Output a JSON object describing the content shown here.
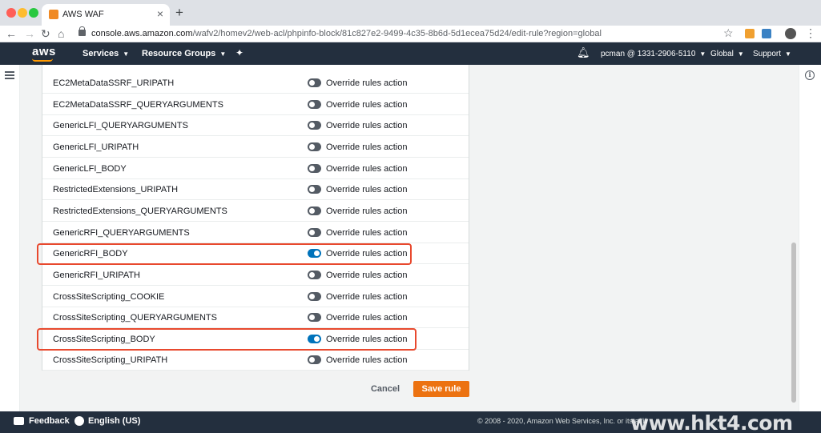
{
  "browser": {
    "tab_title": "AWS WAF",
    "tab_close": "×",
    "new_tab": "+",
    "url_host": "console.aws.amazon.com",
    "url_path": "/wafv2/homev2/web-acl/phpinfo-block/81c827e2-9499-4c35-8b6d-5d1ecea75d24/edit-rule?region=global"
  },
  "aws_nav": {
    "logo": "aws",
    "services": "Services",
    "resource_groups": "Resource Groups",
    "account": "pcman @ 1331-2906-5110",
    "region": "Global",
    "support": "Support"
  },
  "rules": [
    {
      "name": "EC2MetaDataSSRF_URIPATH",
      "toggle_label": "Override rules action",
      "enabled": false,
      "highlighted": false
    },
    {
      "name": "EC2MetaDataSSRF_QUERYARGUMENTS",
      "toggle_label": "Override rules action",
      "enabled": false,
      "highlighted": false
    },
    {
      "name": "GenericLFI_QUERYARGUMENTS",
      "toggle_label": "Override rules action",
      "enabled": false,
      "highlighted": false
    },
    {
      "name": "GenericLFI_URIPATH",
      "toggle_label": "Override rules action",
      "enabled": false,
      "highlighted": false
    },
    {
      "name": "GenericLFI_BODY",
      "toggle_label": "Override rules action",
      "enabled": false,
      "highlighted": false
    },
    {
      "name": "RestrictedExtensions_URIPATH",
      "toggle_label": "Override rules action",
      "enabled": false,
      "highlighted": false
    },
    {
      "name": "RestrictedExtensions_QUERYARGUMENTS",
      "toggle_label": "Override rules action",
      "enabled": false,
      "highlighted": false
    },
    {
      "name": "GenericRFI_QUERYARGUMENTS",
      "toggle_label": "Override rules action",
      "enabled": false,
      "highlighted": false
    },
    {
      "name": "GenericRFI_BODY",
      "toggle_label": "Override rules action",
      "enabled": true,
      "highlighted": true
    },
    {
      "name": "GenericRFI_URIPATH",
      "toggle_label": "Override rules action",
      "enabled": false,
      "highlighted": false
    },
    {
      "name": "CrossSiteScripting_COOKIE",
      "toggle_label": "Override rules action",
      "enabled": false,
      "highlighted": false
    },
    {
      "name": "CrossSiteScripting_QUERYARGUMENTS",
      "toggle_label": "Override rules action",
      "enabled": false,
      "highlighted": false
    },
    {
      "name": "CrossSiteScripting_BODY",
      "toggle_label": "Override rules action",
      "enabled": true,
      "highlighted": true
    },
    {
      "name": "CrossSiteScripting_URIPATH",
      "toggle_label": "Override rules action",
      "enabled": false,
      "highlighted": false
    }
  ],
  "actions": {
    "cancel": "Cancel",
    "save": "Save rule"
  },
  "footer": {
    "feedback": "Feedback",
    "language": "English (US)",
    "copyright": "© 2008 - 2020, Amazon Web Services, Inc. or its affili",
    "watermark": "www.hkt4.com"
  },
  "colors": {
    "aws_nav_bg": "#232f3e",
    "toggle_on": "#0073bb",
    "save_button": "#ec7211",
    "highlight_border": "#e8492e"
  }
}
